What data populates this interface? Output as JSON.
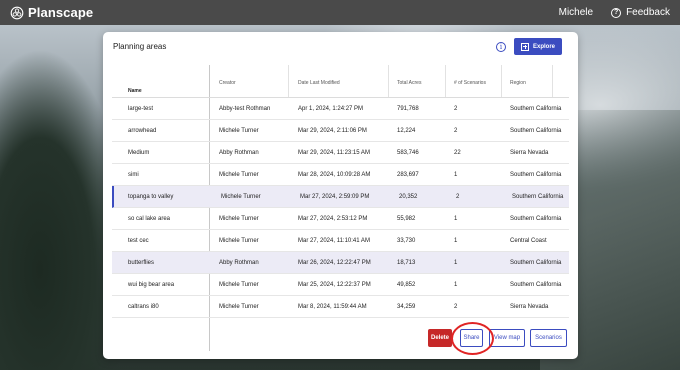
{
  "app": {
    "name": "Planscape",
    "user": "Michele",
    "feedback_label": "Feedback",
    "help_icon": "question-circle-icon",
    "logo_icon": "planscape-logo-icon"
  },
  "panel": {
    "title": "Planning areas",
    "info_icon": "info-icon",
    "explore_label": "Explore",
    "explore_icon": "add-box-icon"
  },
  "table": {
    "headers": {
      "name": "Name",
      "creator": "Creator",
      "date": "Date Last Modified",
      "acres": "Total Acres",
      "scenarios": "# of Scenarios",
      "region": "Region"
    },
    "rows": [
      {
        "name": "large-test",
        "creator": "Abby-test Rothman",
        "date": "Apr 1, 2024, 1:24:27 PM",
        "acres": "791,768",
        "scenarios": "2",
        "region": "Southern California"
      },
      {
        "name": "arrowhead",
        "creator": "Michele Turner",
        "date": "Mar 29, 2024, 2:11:06 PM",
        "acres": "12,224",
        "scenarios": "2",
        "region": "Southern California"
      },
      {
        "name": "Medium",
        "creator": "Abby Rothman",
        "date": "Mar 29, 2024, 11:23:15 AM",
        "acres": "583,746",
        "scenarios": "22",
        "region": "Sierra Nevada"
      },
      {
        "name": "simi",
        "creator": "Michele Turner",
        "date": "Mar 28, 2024, 10:09:28 AM",
        "acres": "283,697",
        "scenarios": "1",
        "region": "Southern California"
      },
      {
        "name": "topanga to valley",
        "creator": "Michele Turner",
        "date": "Mar 27, 2024, 2:59:09 PM",
        "acres": "20,352",
        "scenarios": "2",
        "region": "Southern California"
      },
      {
        "name": "so cal lake area",
        "creator": "Michele Turner",
        "date": "Mar 27, 2024, 2:53:12 PM",
        "acres": "55,982",
        "scenarios": "1",
        "region": "Southern California"
      },
      {
        "name": "test cec",
        "creator": "Michele Turner",
        "date": "Mar 27, 2024, 11:10:41 AM",
        "acres": "33,730",
        "scenarios": "1",
        "region": "Central Coast"
      },
      {
        "name": "butterflies",
        "creator": "Abby Rothman",
        "date": "Mar 26, 2024, 12:22:47 PM",
        "acres": "18,713",
        "scenarios": "1",
        "region": "Southern California"
      },
      {
        "name": "wui big bear area",
        "creator": "Michele Turner",
        "date": "Mar 25, 2024, 12:22:37 PM",
        "acres": "49,852",
        "scenarios": "1",
        "region": "Southern California"
      },
      {
        "name": "caltrans i80",
        "creator": "Michele Turner",
        "date": "Mar 8, 2024, 11:59:44 AM",
        "acres": "34,259",
        "scenarios": "2",
        "region": "Sierra Nevada"
      }
    ]
  },
  "actions": {
    "delete": "Delete",
    "share": "Share",
    "view_map": "View map",
    "scenarios": "Scenarios"
  },
  "colors": {
    "accent": "#3b4cc0",
    "delete": "#c62828",
    "annotation": "#e02424",
    "row_highlight": "#ecebf6",
    "topbar": "#4a4a4a"
  }
}
